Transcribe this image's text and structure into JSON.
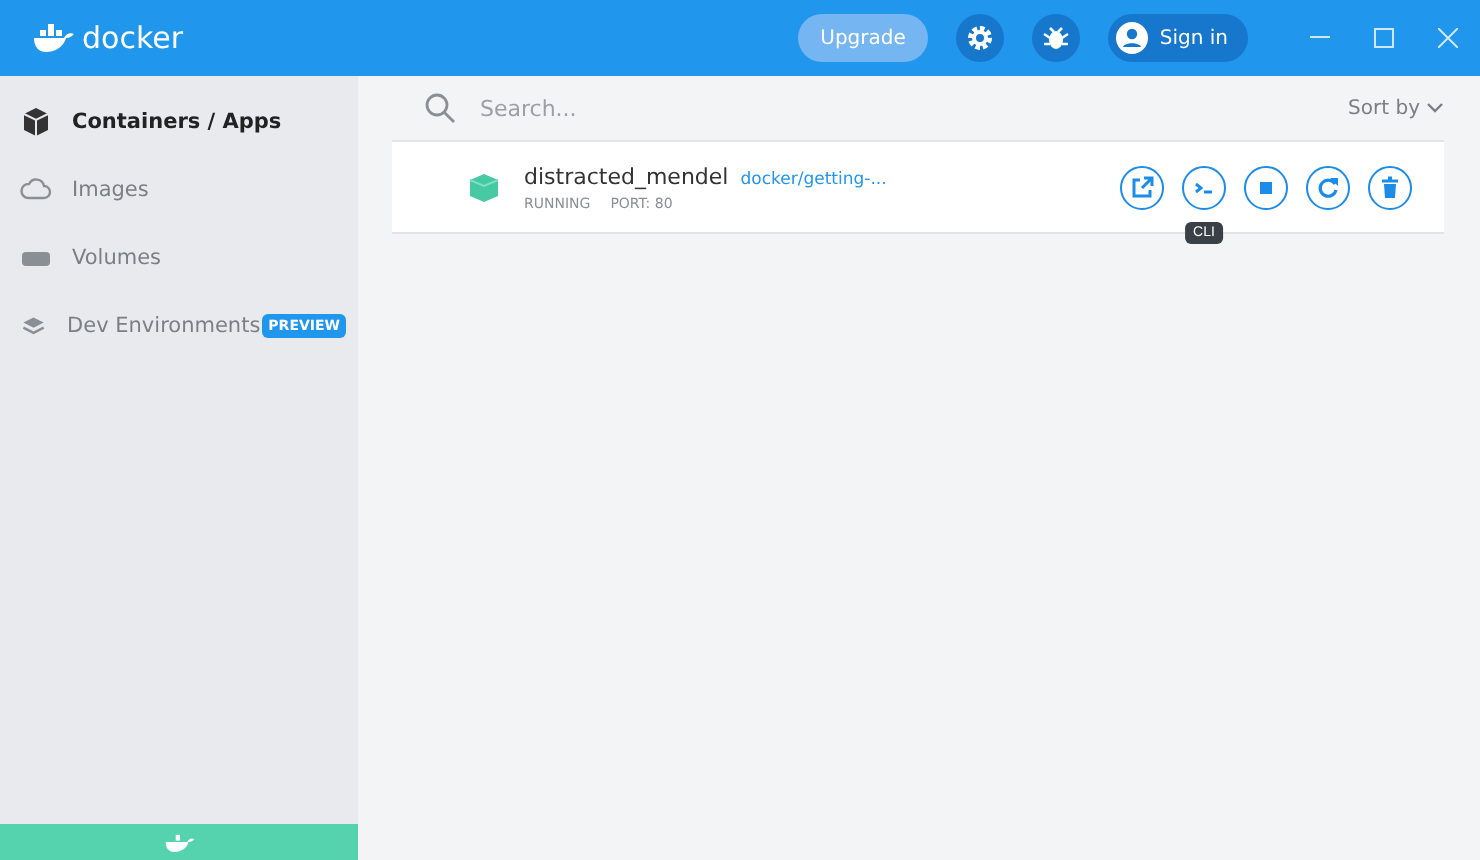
{
  "title_bar": {
    "logo": "docker",
    "upgrade": "Upgrade",
    "sign_in": "Sign in"
  },
  "sidebar": {
    "items": [
      {
        "label": "Containers / Apps",
        "selected": true,
        "kind": "box"
      },
      {
        "label": "Images",
        "selected": false,
        "kind": "cloud"
      },
      {
        "label": "Volumes",
        "selected": false,
        "kind": "disk"
      },
      {
        "label": "Dev Environments",
        "selected": false,
        "kind": "layers",
        "badge": "PREVIEW"
      }
    ]
  },
  "search": {
    "placeholder": "Search..."
  },
  "sort": {
    "label": "Sort by"
  },
  "containers": [
    {
      "name": "distracted_mendel",
      "image": "docker/getting-...",
      "status": "RUNNING",
      "port": "PORT: 80",
      "actions": [
        {
          "kind": "open"
        },
        {
          "kind": "cli",
          "tooltip": "CLI"
        },
        {
          "kind": "stop"
        },
        {
          "kind": "restart"
        },
        {
          "kind": "delete"
        }
      ]
    }
  ]
}
